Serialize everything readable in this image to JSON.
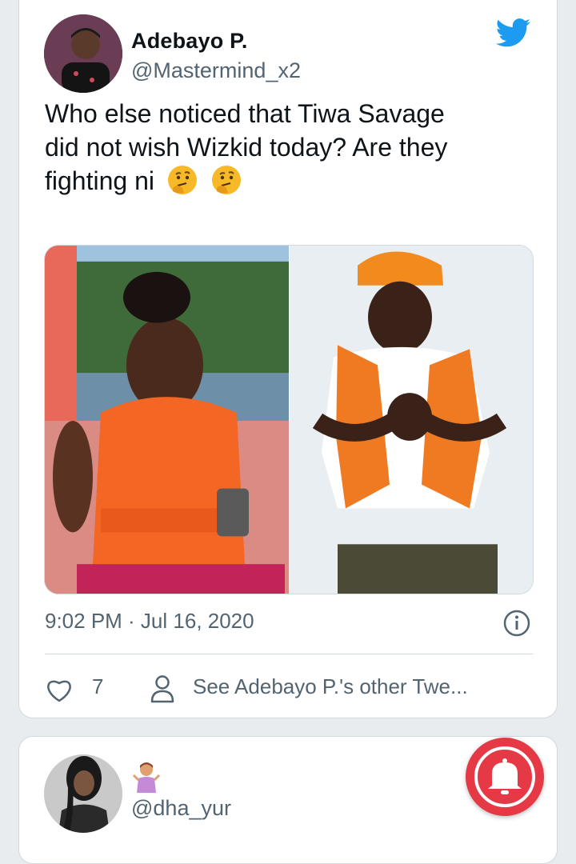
{
  "tweet1": {
    "display_name": "Adebayo P.",
    "handle": "@Mastermind_x2",
    "text_lines": [
      "Who else noticed that Tiwa Savage",
      "did not wish Wizkid today? Are they",
      "fighting ni"
    ],
    "emoji": [
      "thinking-face",
      "thinking-face"
    ],
    "media": {
      "left_description": "woman-in-orange-life-vest",
      "right_description": "man-in-orange-hat-and-vest"
    },
    "timestamp": "9:02 PM · Jul 16, 2020",
    "likes": "7",
    "see_other": "See Adebayo P.'s other Twe..."
  },
  "tweet2": {
    "display_name_emoji": "person-shrugging",
    "handle": "@dha_yur"
  },
  "icons": {
    "brand": "twitter-bird-icon",
    "info": "info-icon",
    "like": "heart-icon",
    "profile": "person-icon",
    "notification": "bell-icon"
  },
  "colors": {
    "twitter_blue": "#1d9bf0",
    "secondary_text": "#536471",
    "fab_red": "#e53946"
  }
}
